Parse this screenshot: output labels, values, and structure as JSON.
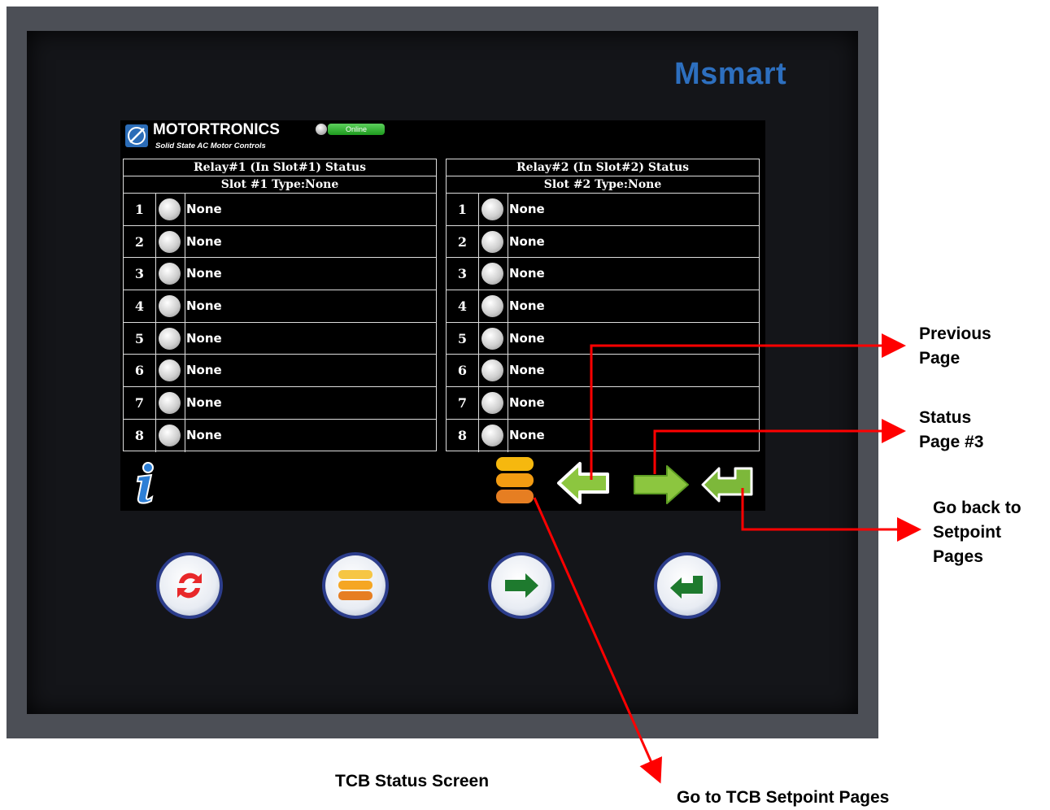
{
  "device": {
    "brand": "Msmart"
  },
  "screen": {
    "company": "MOTORTRONICS",
    "tagline": "Solid State AC Motor Controls",
    "status_label": "Online",
    "panels": [
      {
        "title": "Relay#1 (In Slot#1) Status",
        "type": "Slot #1 Type:None",
        "rows": [
          {
            "num": "1",
            "label": "None"
          },
          {
            "num": "2",
            "label": "None"
          },
          {
            "num": "3",
            "label": "None"
          },
          {
            "num": "4",
            "label": "None"
          },
          {
            "num": "5",
            "label": "None"
          },
          {
            "num": "6",
            "label": "None"
          },
          {
            "num": "7",
            "label": "None"
          },
          {
            "num": "8",
            "label": "None"
          }
        ]
      },
      {
        "title": "Relay#2 (In Slot#2) Status",
        "type": "Slot #2 Type:None",
        "rows": [
          {
            "num": "1",
            "label": "None"
          },
          {
            "num": "2",
            "label": "None"
          },
          {
            "num": "3",
            "label": "None"
          },
          {
            "num": "4",
            "label": "None"
          },
          {
            "num": "5",
            "label": "None"
          },
          {
            "num": "6",
            "label": "None"
          },
          {
            "num": "7",
            "label": "None"
          },
          {
            "num": "8",
            "label": "None"
          }
        ]
      }
    ],
    "icons": [
      "info-icon",
      "menu-icon",
      "arrow-left-icon",
      "arrow-right-icon",
      "return-icon"
    ]
  },
  "hardware_buttons": [
    "refresh-icon",
    "menu-icon",
    "arrow-right-icon",
    "return-icon"
  ],
  "annotations": {
    "previous": "Previous\nPage",
    "status": "Status\nPage #3",
    "back": "Go back to\nSetpoint\nPages",
    "tcb": "Go to TCB Setpoint Pages"
  },
  "caption": "TCB Status Screen",
  "colors": {
    "accent": "#2d6fbf",
    "arrow_red": "#ff0000",
    "online_green": "#2db52d",
    "nav_green": "#8cc63f",
    "menu_orange": "#f39c12"
  }
}
